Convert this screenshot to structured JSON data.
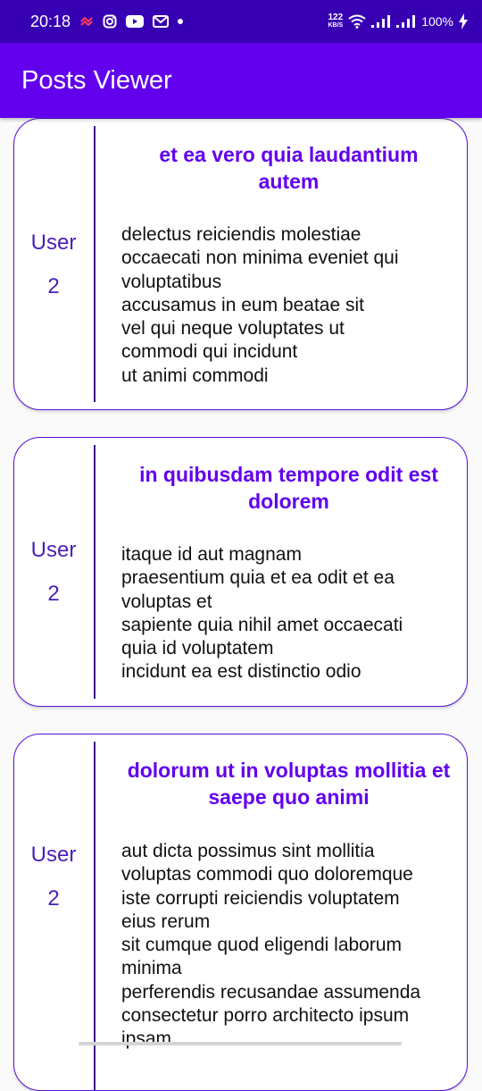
{
  "status_bar": {
    "time": "20:18",
    "network_speed_value": "122",
    "network_speed_unit": "KB/S",
    "battery": "100%",
    "icons": [
      "notification-icon",
      "instagram-icon",
      "youtube-icon",
      "gmail-icon",
      "dot-icon",
      "wifi-icon",
      "signal-icon",
      "signal-icon",
      "charging-icon"
    ]
  },
  "app_bar": {
    "title": "Posts Viewer"
  },
  "colors": {
    "status_bar": "#3700b3",
    "app_bar": "#6200ee",
    "title_text": "#6200ee",
    "card_border": "#5a0fd6",
    "user_text": "#4a1fb8"
  },
  "posts": [
    {
      "user_label": "User",
      "user_id": "2",
      "title": "et ea vero quia laudantium autem",
      "body": "delectus reiciendis molestiae\noccaecati non minima eveniet qui\nvoluptatibus\naccusamus in eum beatae sit\nvel qui neque voluptates ut\ncommodi qui incidunt\nut animi commodi"
    },
    {
      "user_label": "User",
      "user_id": "2",
      "title": "in quibusdam tempore odit est dolorem",
      "body": "itaque id aut magnam\npraesentium quia et ea odit et ea\nvoluptas et\nsapiente quia nihil amet occaecati\nquia id voluptatem\nincidunt ea est distinctio odio"
    },
    {
      "user_label": "User",
      "user_id": "2",
      "title": "dolorum ut in voluptas mollitia et saepe quo animi",
      "body": "aut dicta possimus sint mollitia\nvoluptas commodi quo doloremque\niste corrupti reiciendis voluptatem\neius rerum\nsit cumque quod eligendi laborum\nminima\nperferendis recusandae assumenda\nconsectetur porro architecto ipsum\nipsam"
    }
  ]
}
